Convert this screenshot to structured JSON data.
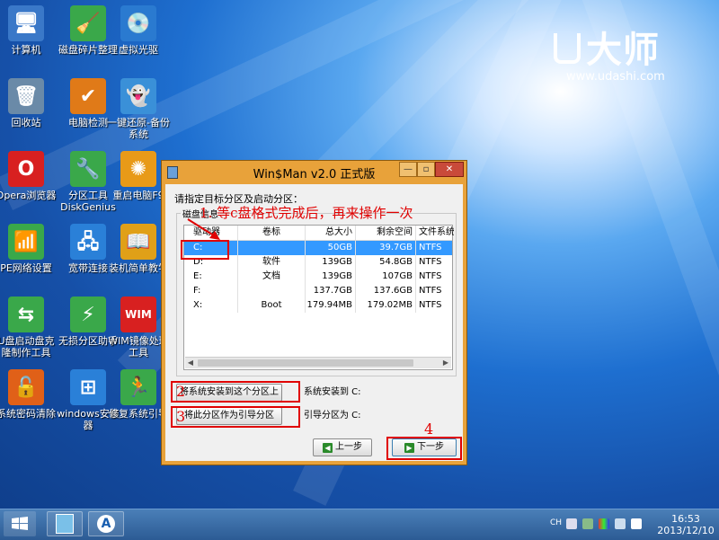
{
  "brand": {
    "name": "大师",
    "url": "www.udashi.com"
  },
  "desktop_icons": [
    {
      "label": "计算机",
      "symbol": "🖥",
      "color": "#3a78c8"
    },
    {
      "label": "磁盘碎片整理",
      "symbol": "🧹",
      "color": "#3aa84a"
    },
    {
      "label": "虚拟光驱",
      "symbol": "💿",
      "color": "#2a7ad0"
    },
    {
      "label": "回收站",
      "symbol": "🗑",
      "color": "#6a8aa8"
    },
    {
      "label": "电脑检测",
      "symbol": "✔",
      "color": "#e07a18"
    },
    {
      "label": "一键还原-备份系统",
      "symbol": "👻",
      "color": "#3a90d8"
    },
    {
      "label": "Opera浏览器",
      "symbol": "O",
      "color": "#d82020"
    },
    {
      "label": "分区工具DiskGenius",
      "symbol": "🔧",
      "color": "#3aa84a"
    },
    {
      "label": "重启电脑F9",
      "symbol": "✺",
      "color": "#e89a18"
    },
    {
      "label": "PE网络设置",
      "symbol": "📶",
      "color": "#3aa84a"
    },
    {
      "label": "宽带连接",
      "symbol": "🖧",
      "color": "#2a80d8"
    },
    {
      "label": "装机简单教学",
      "symbol": "📖",
      "color": "#e0a018"
    },
    {
      "label": "U盘启动盘克隆制作工具",
      "symbol": "⇆",
      "color": "#3aa84a"
    },
    {
      "label": "无损分区助手",
      "symbol": "⚡",
      "color": "#3aa84a"
    },
    {
      "label": "WIM镜像处理工具",
      "symbol": "WIM",
      "color": "#d82020"
    },
    {
      "label": "系统密码清除",
      "symbol": "🔓",
      "color": "#e06018"
    },
    {
      "label": "windows安装器",
      "symbol": "⊞",
      "color": "#2a80d8"
    },
    {
      "label": "修复系统引导",
      "symbol": "🏃",
      "color": "#3aa84a"
    }
  ],
  "window": {
    "title": "Win$Man v2.0 正式版",
    "prompt": "请指定目标分区及启动分区：",
    "group_caption": "磁盘信息",
    "columns": [
      "驱动器",
      "卷标",
      "总大小",
      "剩余空间",
      "文件系统"
    ],
    "rows": [
      {
        "drive": "C:",
        "label": "",
        "total": "50GB",
        "free": "39.7GB",
        "fs": "NTFS",
        "selected": true
      },
      {
        "drive": "D:",
        "label": "软件",
        "total": "139GB",
        "free": "54.8GB",
        "fs": "NTFS",
        "selected": false
      },
      {
        "drive": "E:",
        "label": "文档",
        "total": "139GB",
        "free": "107GB",
        "fs": "NTFS",
        "selected": false
      },
      {
        "drive": "F:",
        "label": "",
        "total": "137.7GB",
        "free": "137.6GB",
        "fs": "NTFS",
        "selected": false
      },
      {
        "drive": "X:",
        "label": "Boot",
        "total": "179.94MB",
        "free": "179.02MB",
        "fs": "NTFS",
        "selected": false
      }
    ],
    "install_button": "将系统安装到这个分区上",
    "install_status": "系统安装到  C:",
    "boot_button": "将此分区作为引导分区",
    "boot_status": "引导分区为  C:",
    "prev_button": "上一步",
    "next_button": "下一步"
  },
  "annotations": {
    "step1": "1. 等c盘格式完成后，再来操作一次",
    "step2": "2",
    "step3": "3",
    "step4": "4",
    "color": "#e00000"
  },
  "taskbar": {
    "keyboard": "CH",
    "time": "16:53",
    "date": "2013/12/10"
  }
}
